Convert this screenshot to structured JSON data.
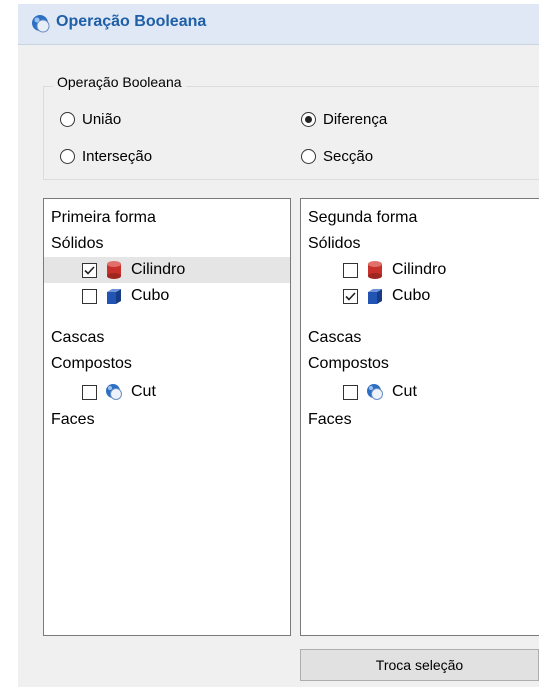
{
  "window": {
    "title": "Operação Booleana"
  },
  "operation_group": {
    "title": "Operação Booleana",
    "options": [
      {
        "label": "União",
        "selected": false
      },
      {
        "label": "Diferença",
        "selected": true
      },
      {
        "label": "Interseção",
        "selected": false
      },
      {
        "label": "Secção",
        "selected": false
      }
    ]
  },
  "first_list": {
    "header": "Primeira forma",
    "solids_label": "Sólidos",
    "solids": [
      {
        "label": "Cilindro",
        "checked": true,
        "icon": "cylinder-icon",
        "highlighted": true
      },
      {
        "label": "Cubo",
        "checked": false,
        "icon": "cube-icon",
        "highlighted": false
      }
    ],
    "shells_label": "Cascas",
    "compounds_label": "Compostos",
    "compounds": [
      {
        "label": "Cut",
        "checked": false,
        "icon": "boolean-cut-icon"
      }
    ],
    "faces_label": "Faces"
  },
  "second_list": {
    "header": "Segunda forma",
    "solids_label": "Sólidos",
    "solids": [
      {
        "label": "Cilindro",
        "checked": false,
        "icon": "cylinder-icon"
      },
      {
        "label": "Cubo",
        "checked": true,
        "icon": "cube-icon"
      }
    ],
    "shells_label": "Cascas",
    "compounds_label": "Compostos",
    "compounds": [
      {
        "label": "Cut",
        "checked": false,
        "icon": "boolean-cut-icon"
      }
    ],
    "faces_label": "Faces"
  },
  "swap_button": {
    "label": "Troca seleção"
  },
  "colors": {
    "title_text": "#1f5fa8",
    "title_bg": "#dfe8f4",
    "cylinder_red": "#c8312b",
    "cube_blue": "#2255b3"
  }
}
